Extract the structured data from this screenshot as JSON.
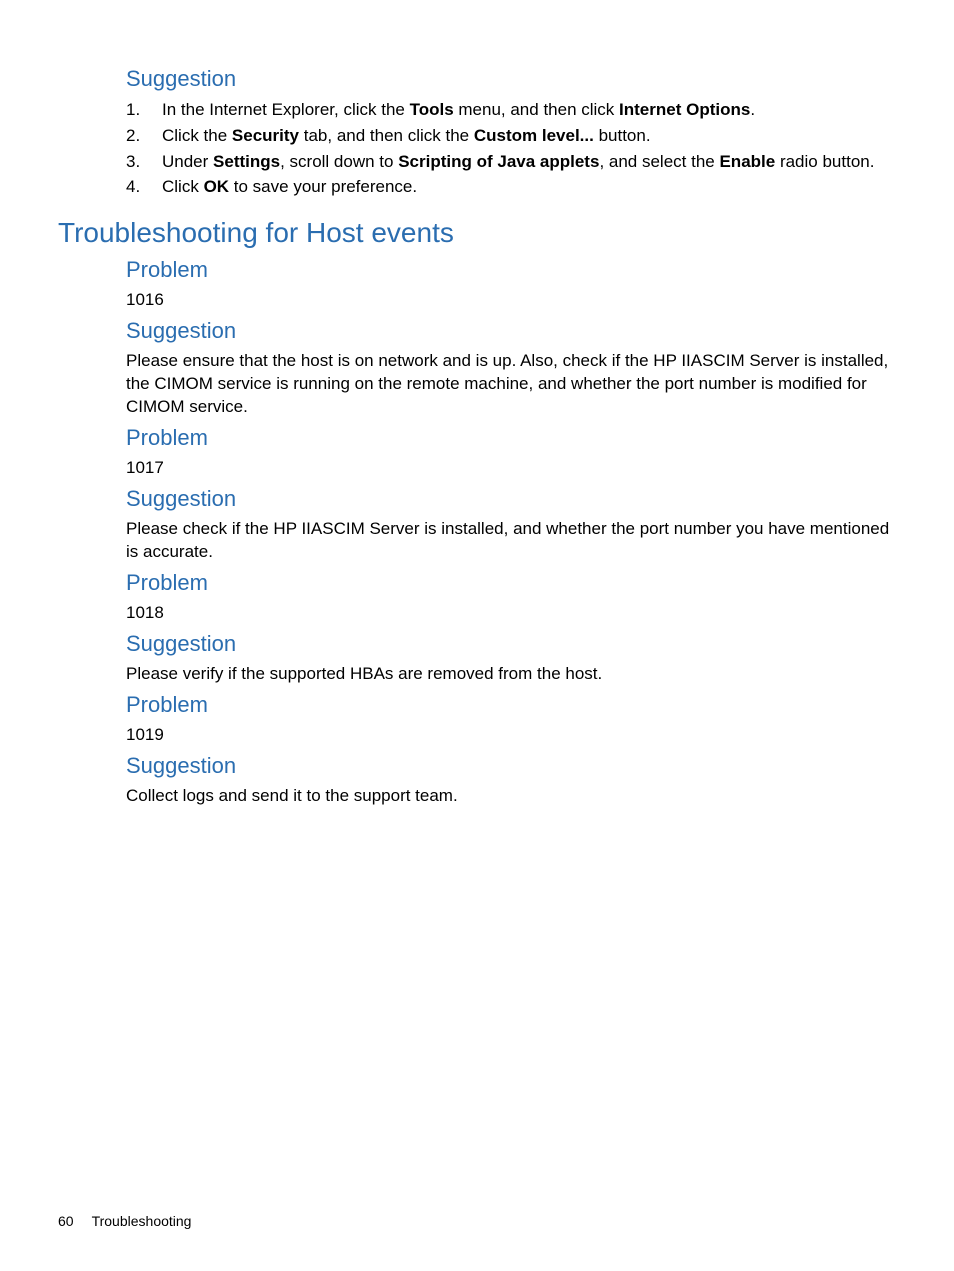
{
  "top": {
    "suggestion_heading": "Suggestion",
    "steps": {
      "s1_pre": "In the Internet Explorer, click the ",
      "s1_b1": "Tools",
      "s1_mid": " menu, and then click ",
      "s1_b2": "Internet Options",
      "s1_post": ".",
      "s2_pre": "Click the ",
      "s2_b1": "Security",
      "s2_mid": " tab, and then click the ",
      "s2_b2": "Custom level...",
      "s2_post": " button.",
      "s3_pre": "Under ",
      "s3_b1": "Settings",
      "s3_mid1": ", scroll down to ",
      "s3_b2": "Scripting of Java applets",
      "s3_mid2": ", and select the ",
      "s3_b3": "Enable",
      "s3_post": " radio button.",
      "s4_pre": "Click ",
      "s4_b1": "OK",
      "s4_post": " to save your preference."
    }
  },
  "section_heading": "Troubleshooting for Host events",
  "labels": {
    "problem": "Problem",
    "suggestion": "Suggestion"
  },
  "entries": {
    "p1_code": "1016",
    "p1_sugg": "Please ensure that the host is on network and is up. Also, check if the HP IIASCIM Server is installed, the CIMOM service is running on the remote machine, and whether the port number is modified for CIMOM service.",
    "p2_code": "1017",
    "p2_sugg": "Please check if the HP IIASCIM Server is installed, and whether the port number you have mentioned is accurate.",
    "p3_code": "1018",
    "p3_sugg": "Please verify if the supported HBAs are removed from the host.",
    "p4_code": "1019",
    "p4_sugg": "Collect logs and send it to the support team."
  },
  "footer": {
    "page_number": "60",
    "section": "Troubleshooting"
  }
}
